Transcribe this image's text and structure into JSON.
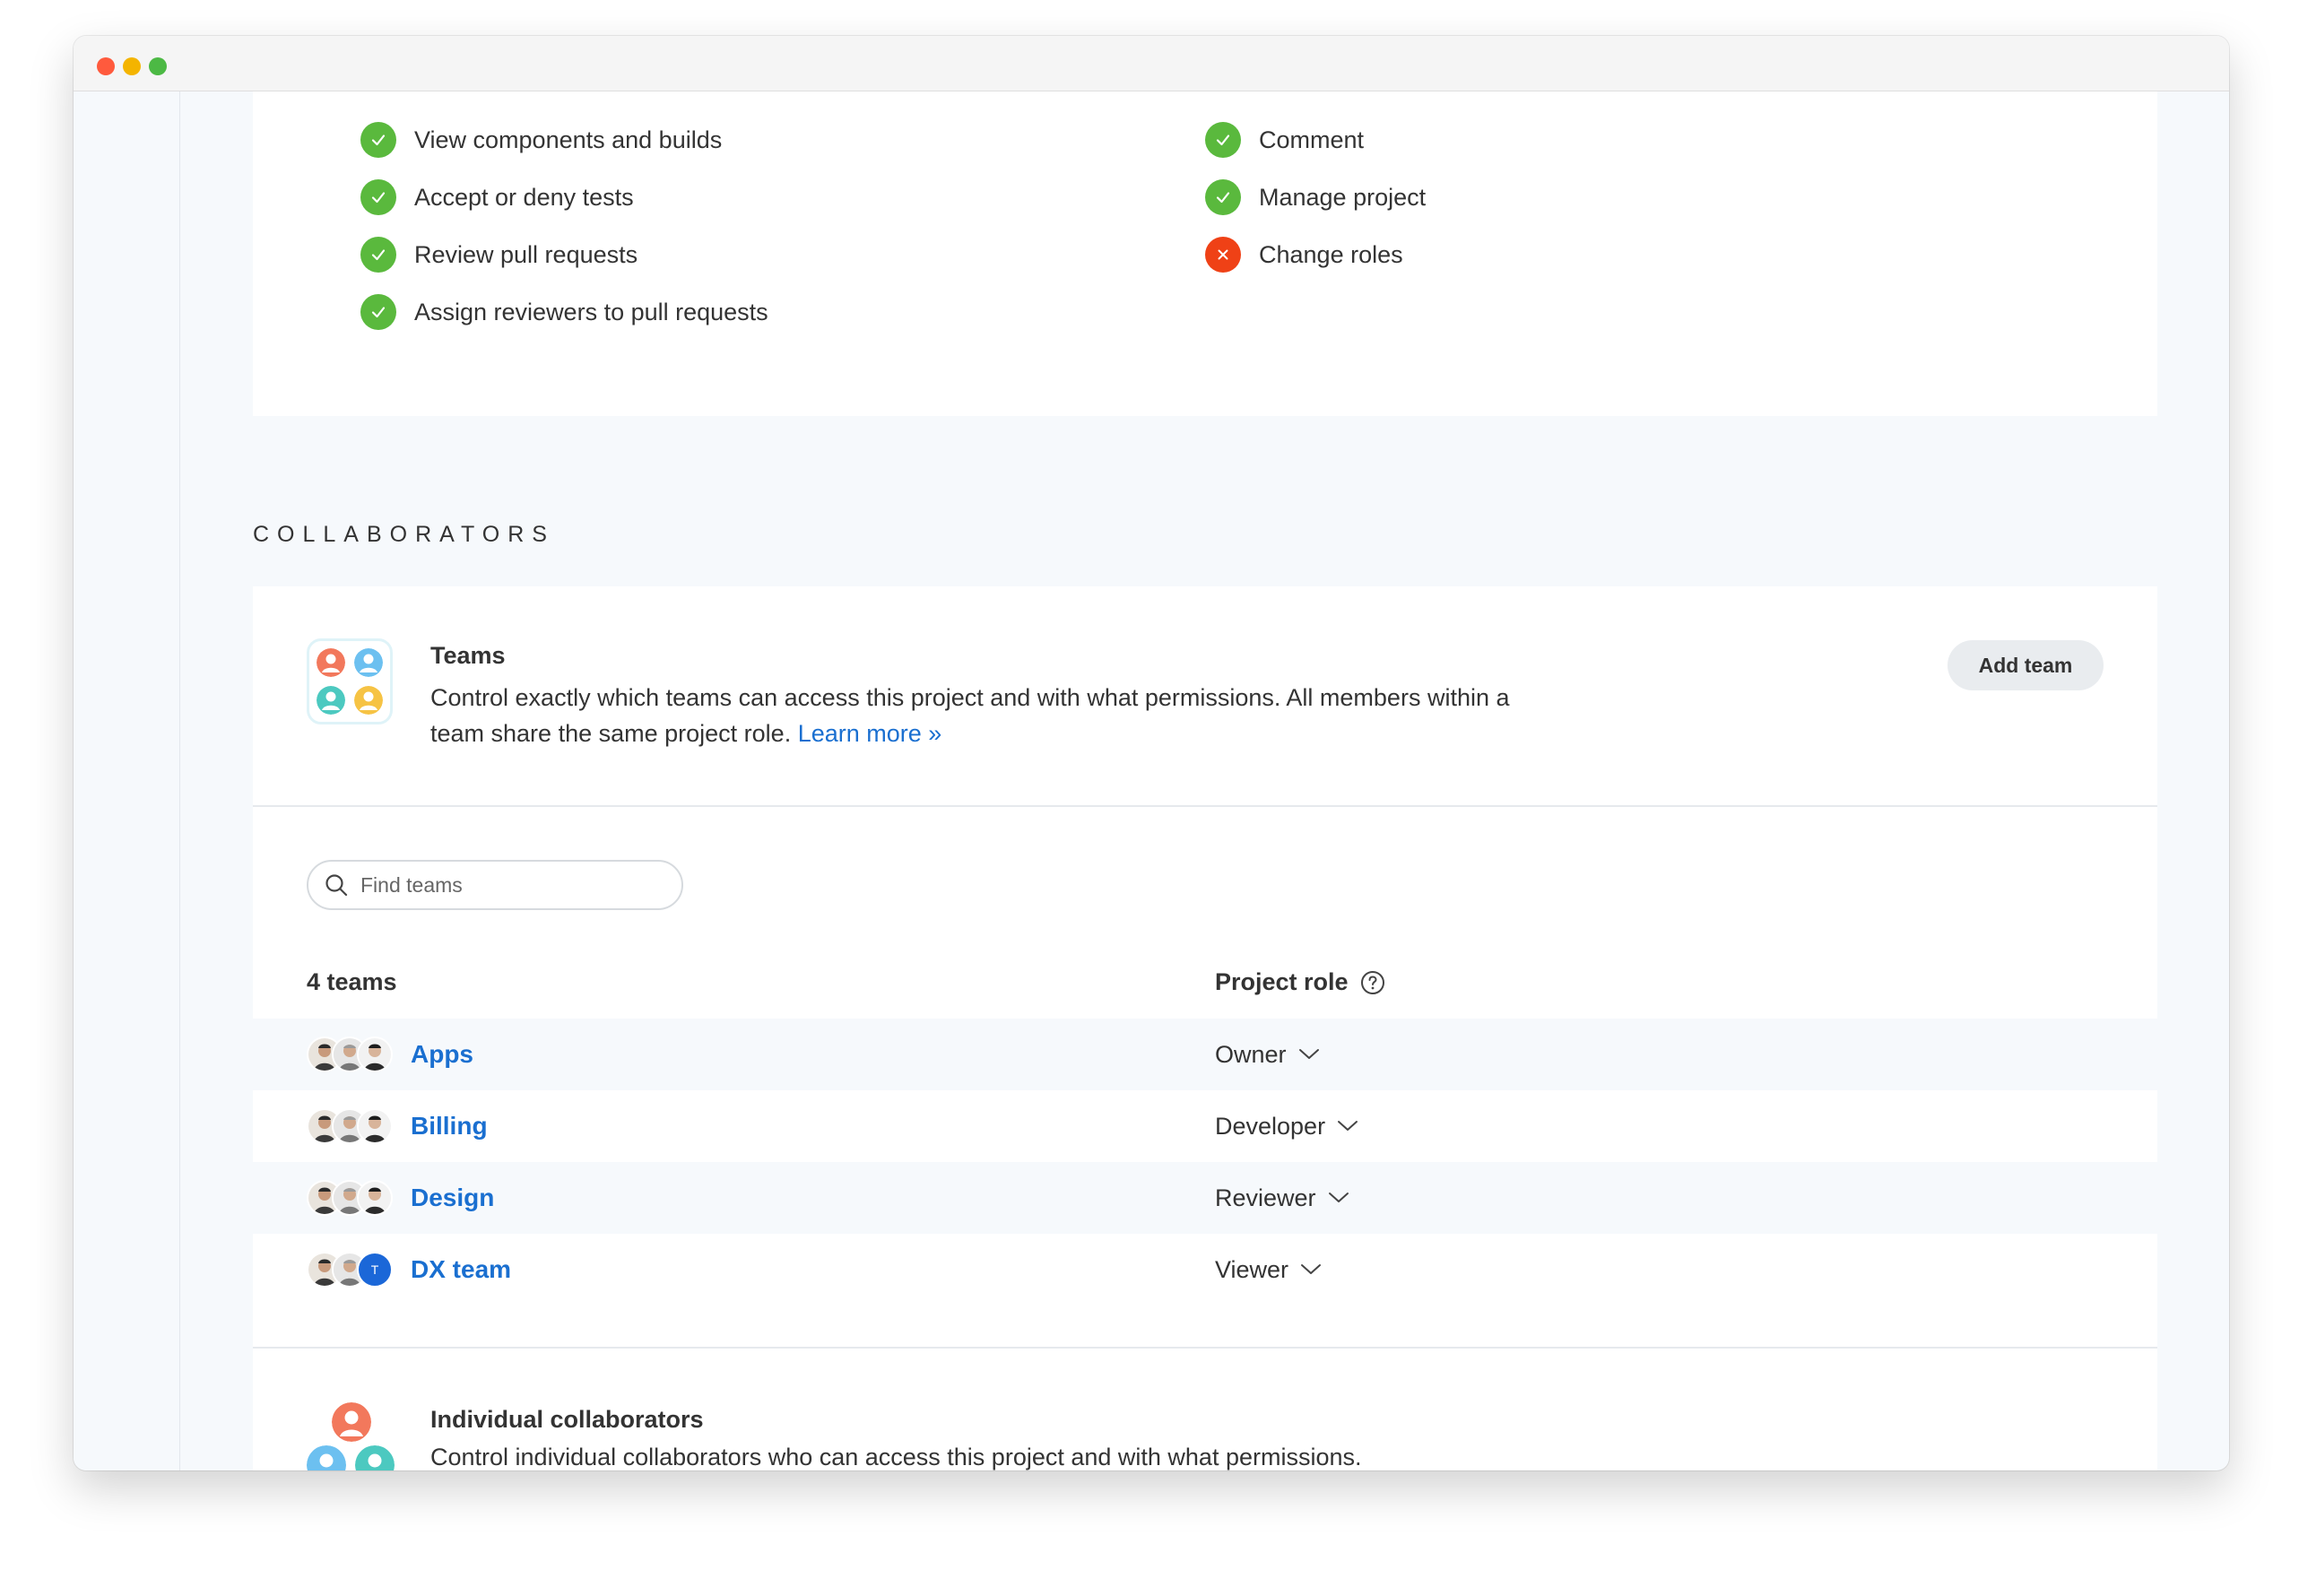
{
  "permissions": {
    "left": [
      {
        "label": "View components and builds",
        "allowed": true
      },
      {
        "label": "Accept or deny tests",
        "allowed": true
      },
      {
        "label": "Review pull requests",
        "allowed": true
      },
      {
        "label": "Assign reviewers to pull requests",
        "allowed": true
      }
    ],
    "right": [
      {
        "label": "Comment",
        "allowed": true
      },
      {
        "label": "Manage project",
        "allowed": true
      },
      {
        "label": "Change roles",
        "allowed": false
      }
    ]
  },
  "collaborators": {
    "section_label": "COLLABORATORS",
    "teams": {
      "title": "Teams",
      "description": "Control exactly which teams can access this project and with what permissions. All members within a team share the same project role.",
      "learn_more": "Learn more »",
      "add_button": "Add team",
      "search_placeholder": "Find teams",
      "count_header": "4 teams",
      "role_header": "Project role",
      "rows": [
        {
          "name": "Apps",
          "role": "Owner"
        },
        {
          "name": "Billing",
          "role": "Developer"
        },
        {
          "name": "Design",
          "role": "Reviewer"
        },
        {
          "name": "DX team",
          "role": "Viewer",
          "extra_avatar_initial": "T"
        }
      ]
    },
    "individual": {
      "title": "Individual collaborators",
      "description": "Control individual collaborators who can access this project and with what permissions."
    }
  },
  "colors": {
    "check_green": "#5ab93d",
    "deny_red": "#ef4116",
    "link_blue": "#1a6fd0"
  }
}
